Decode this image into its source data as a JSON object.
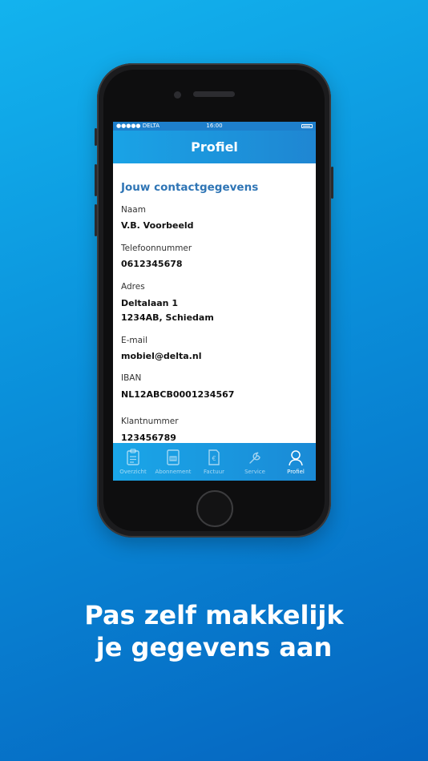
{
  "status_bar": {
    "carrier": "●●●●● DELTA",
    "time": "16:00"
  },
  "header": {
    "title": "Profiel"
  },
  "profile": {
    "section_title": "Jouw contactgegevens",
    "fields": [
      {
        "label": "Naam",
        "value": "V.B. Voorbeeld"
      },
      {
        "label": "Telefoonnummer",
        "value": "0612345678"
      },
      {
        "label": "Adres",
        "value_line1": "Deltalaan 1",
        "value_line2": "1234AB, Schiedam"
      },
      {
        "label": "E-mail",
        "value": "mobiel@delta.nl"
      },
      {
        "label": "IBAN",
        "value": "NL12ABCB0001234567"
      },
      {
        "label": "Klantnummer",
        "value": "123456789"
      }
    ]
  },
  "tabbar": {
    "tabs": [
      {
        "label": "Overzicht",
        "icon": "clipboard-icon",
        "active": false
      },
      {
        "label": "Abonnement",
        "icon": "meter-icon",
        "active": false
      },
      {
        "label": "Factuur",
        "icon": "invoice-euro-icon",
        "active": false
      },
      {
        "label": "Service",
        "icon": "wrench-icon",
        "active": false
      },
      {
        "label": "Profiel",
        "icon": "user-icon",
        "active": true
      }
    ]
  },
  "headline": {
    "line1": "Pas zelf makkelijk",
    "line2": "je gegevens aan"
  },
  "colors": {
    "background": "#0a8fda",
    "accent": "#2f75b5",
    "tabbar": "#1a8ad6"
  }
}
